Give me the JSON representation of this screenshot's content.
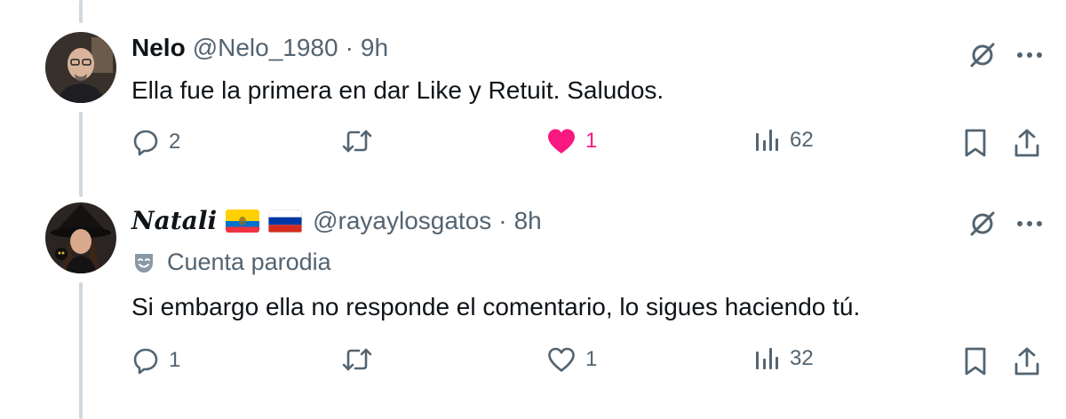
{
  "tweets": [
    {
      "display_name": "Nelo",
      "handle": "@Nelo_1980",
      "separator": "·",
      "time": "9h",
      "text": "Ella fue la primera en dar Like y Retuit. Saludos.",
      "avatar": "bald-man-glasses-avatar",
      "replies": "2",
      "retweets": "",
      "likes": "1",
      "liked": true,
      "views": "62"
    },
    {
      "display_name": "Natali",
      "flags": [
        "ecuador-flag",
        "russia-flag"
      ],
      "handle": "@rayaylosgatos",
      "separator": "·",
      "time": "8h",
      "badge": "Cuenta parodia",
      "text": "Si embargo ella no responde el comentario, lo sigues haciendo tú.",
      "avatar": "woman-witch-hat-avatar",
      "replies": "1",
      "retweets": "",
      "likes": "1",
      "liked": false,
      "views": "32"
    }
  ],
  "colors": {
    "text": "#0f1419",
    "secondary": "#536471",
    "like": "#f91880",
    "thread_line": "#cfd9de"
  }
}
